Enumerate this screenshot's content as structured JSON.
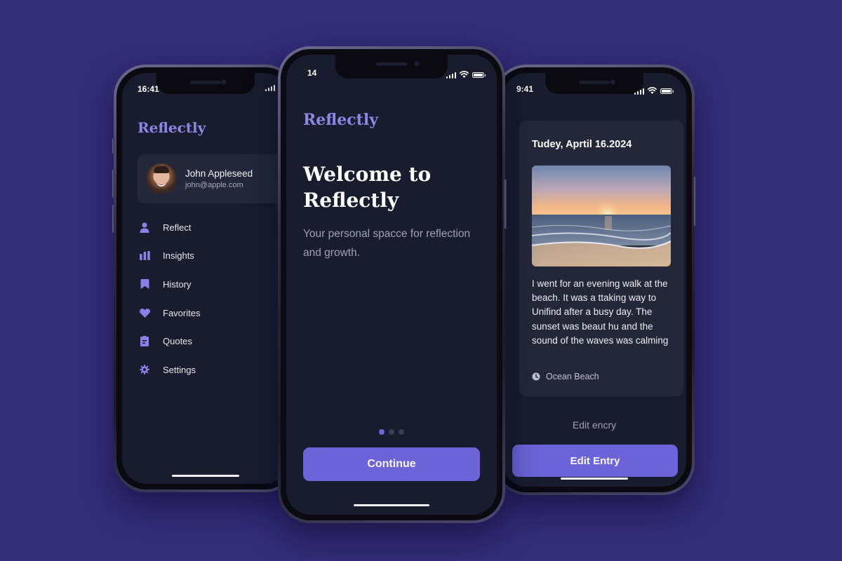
{
  "colors": {
    "background": "#342d78",
    "screen": "#181c2c",
    "card": "#232838",
    "accent": "#6d63d8",
    "brand_text": "#8e86e6"
  },
  "left_phone": {
    "status_time": "16:41",
    "brand": "Reflectly",
    "profile": {
      "name": "John Appleseed",
      "email": "john@apple.com"
    },
    "menu": [
      {
        "label": "Reflect",
        "icon": "person-icon"
      },
      {
        "label": "Insights",
        "icon": "bar-chart-icon"
      },
      {
        "label": "History",
        "icon": "bookmark-icon"
      },
      {
        "label": "Favorites",
        "icon": "heart-icon"
      },
      {
        "label": "Quotes",
        "icon": "quote-card-icon"
      },
      {
        "label": "Settings",
        "icon": "gear-icon"
      }
    ]
  },
  "center_phone": {
    "status_time": "14",
    "brand": "Reflectly",
    "title": "Welcome to Reflectly",
    "subtitle": "Your personal spacce for reflection and growth.",
    "pagination": {
      "total": 3,
      "active": 1
    },
    "continue_label": "Continue"
  },
  "right_phone": {
    "status_time": "9:41",
    "entry": {
      "date": "Tudey, Aprtil 16.2024",
      "photo": "beach-sunset-photo",
      "text": "I went for an evening walk at the beach. It was a ttaking way to Unifind after a busy day. The sunset was beaut hu  and the sound of the waves was calming",
      "location": "Ocean Beach"
    },
    "edit_link_label": "Edit encry",
    "edit_button_label": "Edit Entry"
  }
}
